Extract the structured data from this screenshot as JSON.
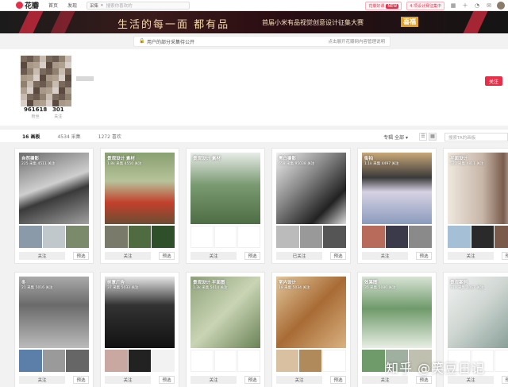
{
  "nav": {
    "logo": "花瓣",
    "items": [
      "首页",
      "发现"
    ],
    "search_scope": "采集",
    "search_placeholder": "搜索你喜欢的",
    "pill_left": "花瓣好课",
    "pill_left_tag": "NEW",
    "pill_right": "4 项设计赛征集中"
  },
  "banner": {
    "main": "生活的每一面 都有品",
    "sub": "首届小米有品视觉创意设计征集大赛",
    "badge": "喜福"
  },
  "notice": {
    "text": "用户的部分采集待公开",
    "link": "点击展开花瓣网内容管理说明"
  },
  "profile": {
    "stats": [
      {
        "num": "961618",
        "label": "粉丝"
      },
      {
        "num": "301",
        "label": "关注"
      }
    ],
    "follow_label": "关注"
  },
  "tabs": {
    "items": [
      "16 画板",
      "4534 采集",
      "1272 喜欢"
    ],
    "filter": "专辑 全部",
    "search_placeholder": "搜索TA的画板"
  },
  "cards": [
    {
      "title": "自然摄影",
      "count": "225 采集  4511 关注",
      "follow": "关注",
      "edit": "预选"
    },
    {
      "title": "景观设计 素材",
      "count": "1.8k 采集  4550 关注",
      "follow": "关注",
      "edit": "预选"
    },
    {
      "title": "景观设计 素材",
      "count": "",
      "follow": "关注",
      "edit": "预选"
    },
    {
      "title": "黑白摄影",
      "count": "658 采集  95038 关注",
      "follow": "已关注",
      "edit": "预选"
    },
    {
      "title": "街拍",
      "count": "1.1k 采集  4497 关注",
      "follow": "关注",
      "edit": "预选"
    },
    {
      "title": "平面设计",
      "count": "521 采集  4811 关注",
      "follow": "关注",
      "edit": "预选"
    },
    {
      "title": "冬",
      "count": "21 采集  5016 关注",
      "follow": "关注",
      "edit": "预选"
    },
    {
      "title": "创意广告",
      "count": "37 采集  5033 关注",
      "follow": "关注",
      "edit": "预选"
    },
    {
      "title": "景观设计 平面图",
      "count": "1.3k 采集  5014 关注",
      "follow": "关注",
      "edit": "预选"
    },
    {
      "title": "室内设计",
      "count": "18 采集  5034 关注",
      "follow": "关注",
      "edit": "预选"
    },
    {
      "title": "效果图",
      "count": "35 采集  5080 关注",
      "follow": "关注",
      "edit": "预选"
    },
    {
      "title": "景观案例",
      "count": "379 采集  5067 关注",
      "follow": "关注",
      "edit": "预选"
    }
  ],
  "watermark": "知乎 @笑豆日记"
}
